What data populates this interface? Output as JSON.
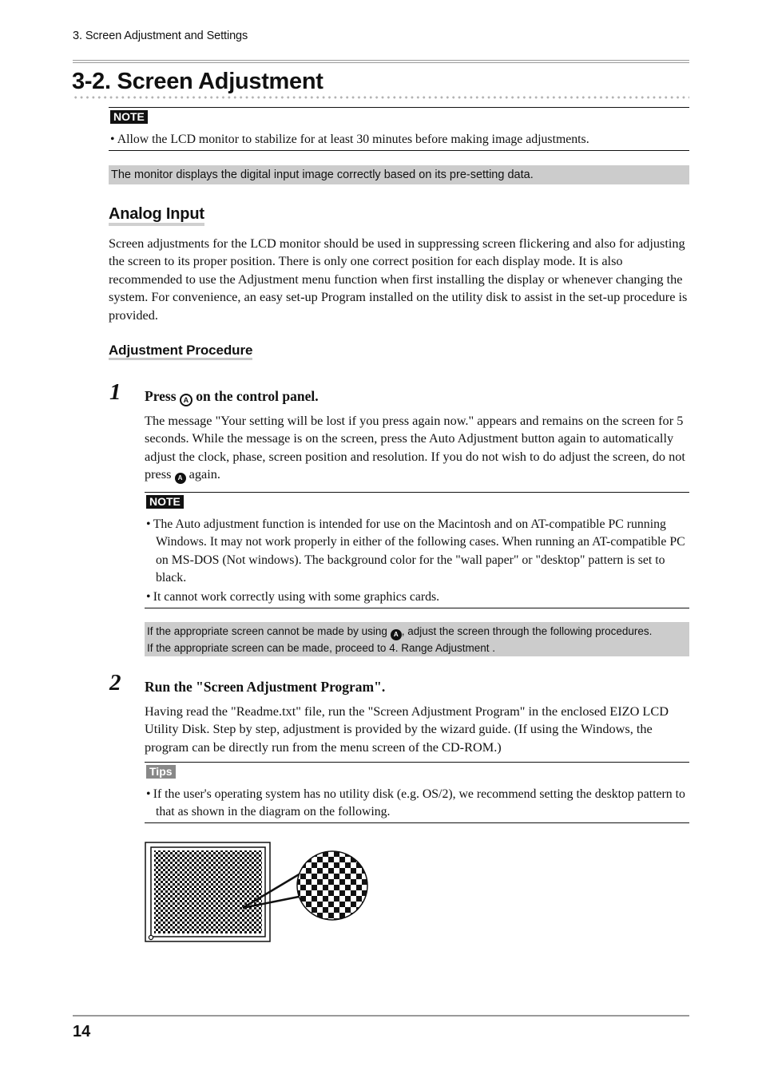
{
  "running_head": "3. Screen Adjustment and Settings",
  "page_title": "3-2. Screen Adjustment",
  "note1": {
    "badge": "NOTE",
    "bullets": [
      "Allow the LCD monitor to stabilize for at least 30 minutes before making image adjustments."
    ]
  },
  "digital_box": "The monitor displays the digital input image correctly based on its pre-setting data.",
  "analog": {
    "heading": "Analog Input",
    "paragraph": "Screen adjustments for the LCD monitor should be used in suppressing screen flickering and also for adjusting the screen to its proper position. There is only one correct position for each display mode. It is also recommended to use the Adjustment menu function when first installing the display or whenever changing the system. For convenience, an easy set-up Program installed on the utility disk to assist in the set-up procedure is provided."
  },
  "procedure": {
    "heading": "Adjustment Procedure",
    "steps": [
      {
        "number": "1",
        "title_before": "Press",
        "title_icon": "A",
        "title_after": "on the control panel.",
        "body_before": "The message \"Your setting will be lost if you press again now.\" appears and remains on the screen for 5 seconds. While the message is on the screen, press the Auto Adjustment button again to automatically adjust the clock, phase, screen position and resolution. If you do not wish to do adjust the screen, do not press",
        "body_icon": "A",
        "body_after": "again.",
        "note": {
          "badge": "NOTE",
          "bullets": [
            "The Auto adjustment function is intended for use on the Macintosh and on AT-compatible PC running Windows. It may not work properly in either of the following cases. When running an AT-compatible PC on MS-DOS (Not windows). The background color for the \"wall paper\" or \"desktop\" pattern is set to black.",
            "It cannot work correctly using with some graphics cards."
          ]
        },
        "box_line1_before": "If the appropriate screen cannot be made by using",
        "box_icon": "A",
        "box_line1_after": ", adjust the screen through the following procedures.",
        "box_line2": "If the appropriate screen can be made, proceed to 4. Range Adjustment ."
      },
      {
        "number": "2",
        "title": "Run the \"Screen Adjustment Program\".",
        "body": "Having read the \"Readme.txt\" file, run the \"Screen Adjustment Program\" in the enclosed EIZO LCD Utility Disk. Step by step, adjustment is provided by the wizard guide. (If using the Windows, the program can be directly run from the menu screen of the CD-ROM.)",
        "tips": {
          "badge": "Tips",
          "bullets": [
            "If the user's operating system has no utility disk (e.g. OS/2), we recommend setting the desktop pattern to that as shown in the diagram on the following."
          ]
        }
      }
    ]
  },
  "illustration": {
    "name": "checkerboard desktop pattern on monitor with magnified detail"
  },
  "page_number": "14"
}
